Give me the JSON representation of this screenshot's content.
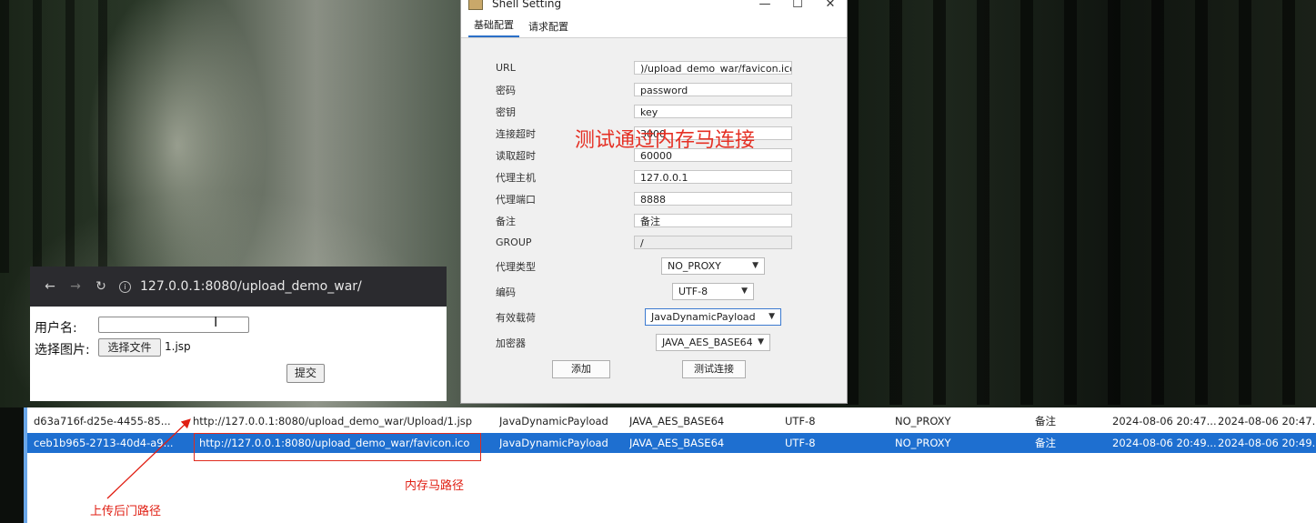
{
  "dialog": {
    "title": "Shell Setting",
    "window_buttons": [
      "—",
      "☐",
      "✕"
    ],
    "tabs": [
      "基础配置",
      "请求配置"
    ],
    "fields": [
      {
        "label": "URL",
        "value": ")/upload_demo_war/favicon.ico"
      },
      {
        "label": "密码",
        "value": "password"
      },
      {
        "label": "密钥",
        "value": "key"
      },
      {
        "label": "连接超时",
        "value": "3000"
      },
      {
        "label": "读取超时",
        "value": "60000"
      },
      {
        "label": "代理主机",
        "value": "127.0.0.1"
      },
      {
        "label": "代理端口",
        "value": "8888"
      },
      {
        "label": "备注",
        "value": "备注"
      },
      {
        "label": "GROUP",
        "value": "/"
      }
    ],
    "selects": [
      {
        "label": "代理类型",
        "value": "NO_PROXY"
      },
      {
        "label": "编码",
        "value": "UTF-8"
      },
      {
        "label": "有效载荷",
        "value": "JavaDynamicPayload"
      },
      {
        "label": "加密器",
        "value": "JAVA_AES_BASE64"
      }
    ],
    "add_button": "添加",
    "test_button": "测试连接"
  },
  "overlay_text": "测试通过内存马连接",
  "browser": {
    "url": "127.0.0.1:8080/upload_demo_war/",
    "username_label": "用户名:",
    "image_label": "选择图片:",
    "choose_file_button": "选择文件",
    "chosen_file": "1.jsp",
    "submit_button": "提交"
  },
  "table": {
    "rows": [
      {
        "id": "d63a716f-d25e-4455-85...",
        "url": "http://127.0.0.1:8080/upload_demo_war/Upload/1.jsp",
        "payload": "JavaDynamicPayload",
        "cryption": "JAVA_AES_BASE64",
        "encoding": "UTF-8",
        "proxy": "NO_PROXY",
        "note": "备注",
        "created": "2024-08-06 20:47...",
        "updated": "2024-08-06 20:47..."
      },
      {
        "id": "ceb1b965-2713-40d4-a9...",
        "url": "http://127.0.0.1:8080/upload_demo_war/favicon.ico",
        "payload": "JavaDynamicPayload",
        "cryption": "JAVA_AES_BASE64",
        "encoding": "UTF-8",
        "proxy": "NO_PROXY",
        "note": "备注",
        "created": "2024-08-06 20:49...",
        "updated": "2024-08-06 20:49..."
      }
    ]
  },
  "annotations": {
    "memshell_path": "内存马路径",
    "upload_backdoor_path": "上传后门路径"
  },
  "colors": {
    "annotation_red": "#e53024",
    "selection_blue": "#1e6fd0"
  }
}
